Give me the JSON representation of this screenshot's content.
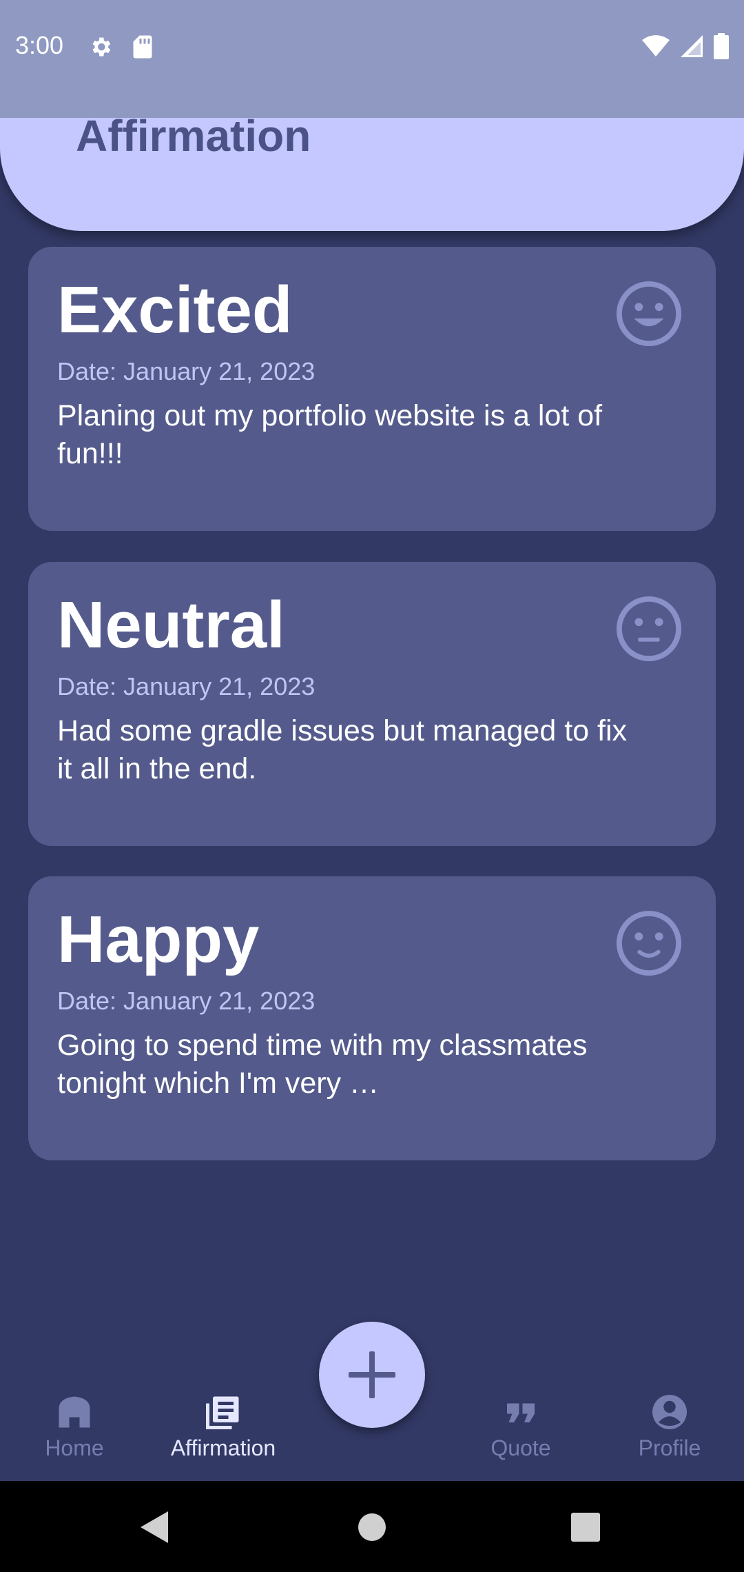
{
  "status_bar": {
    "time": "3:00",
    "icons": [
      "gear-icon",
      "sd-card-icon",
      "wifi-icon",
      "signal-icon",
      "battery-icon"
    ]
  },
  "header": {
    "title": "Affirmation"
  },
  "entries": [
    {
      "mood": "Excited",
      "date": "Date: January 21, 2023",
      "text": "Planing out my portfolio website is a lot of fun!!!",
      "icon": "grinning-face-icon"
    },
    {
      "mood": "Neutral",
      "date": "Date: January 21, 2023",
      "text": "Had some gradle issues but managed to fix it all in the end.",
      "icon": "neutral-face-icon"
    },
    {
      "mood": "Happy",
      "date": "Date: January 21, 2023",
      "text": "Going to spend time with my classmates tonight which I'm very …",
      "icon": "smiling-face-icon"
    }
  ],
  "bottom_nav": {
    "items": [
      {
        "label": "Home",
        "icon": "home-icon",
        "active": false
      },
      {
        "label": "Affirmation",
        "icon": "journal-icon",
        "active": true
      },
      {
        "label": "Quote",
        "icon": "quote-icon",
        "active": false
      },
      {
        "label": "Profile",
        "icon": "profile-icon",
        "active": false
      }
    ],
    "fab_icon": "plus-icon"
  },
  "colors": {
    "background": "#323965",
    "card": "#545b8c",
    "header": "#c4c8ff",
    "status_bar": "#9099c2",
    "accent_text": "#4b5286"
  }
}
